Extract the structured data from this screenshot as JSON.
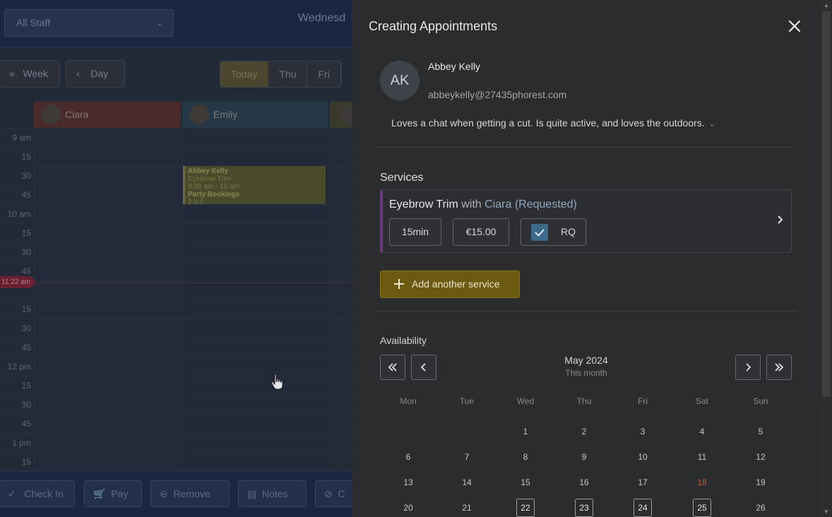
{
  "background": {
    "staff_filter": "All Staff",
    "date_label": "Wednesd",
    "nav": {
      "week": "Week",
      "day": "Day"
    },
    "range_tabs": [
      "Today",
      "Thu",
      "Fri"
    ],
    "staff": [
      "Ciara",
      "Emily"
    ],
    "time_labels": [
      "9 am",
      "15",
      "30",
      "45",
      "10 am",
      "15",
      "30",
      "45",
      "",
      "15",
      "30",
      "45",
      "12 pm",
      "15",
      "30",
      "45",
      "1 pm",
      "15"
    ],
    "appointment": {
      "client": "Abbey Kelly",
      "service": "Eyebrow Trim",
      "time": "9:30 am - 10 am",
      "extra": "Party Bookings",
      "extra2": "2 h 0"
    },
    "now_label": "11:22 am",
    "footer_buttons": [
      "Check In",
      "Pay",
      "Remove",
      "Notes",
      "C"
    ]
  },
  "panel": {
    "title": "Creating Appointments",
    "client": {
      "initials": "AK",
      "name": "Abbey Kelly",
      "email": "abbeykelly@27435phorest.com",
      "notes": "Loves a chat when getting a cut. Is quite active, and loves the outdoors."
    },
    "services": {
      "heading": "Services",
      "item": {
        "name": "Eyebrow Trim",
        "with": "with",
        "staff": "Ciara (Requested)",
        "duration": "15min",
        "price": "€15.00",
        "rq_label": "RQ"
      },
      "add_button": "Add another service"
    },
    "availability": {
      "heading": "Availability",
      "month": "May 2024",
      "month_sub": "This month",
      "weekdays": [
        "Mon",
        "Tue",
        "Wed",
        "Thu",
        "Fri",
        "Sat",
        "Sun"
      ],
      "weeks": [
        [
          "",
          "",
          "1",
          "2",
          "3",
          "4",
          "5"
        ],
        [
          "6",
          "7",
          "8",
          "9",
          "10",
          "11",
          "12"
        ],
        [
          "13",
          "14",
          "15",
          "16",
          "17",
          "18",
          "19"
        ],
        [
          "20",
          "21",
          "22",
          "23",
          "24",
          "25",
          "26"
        ]
      ],
      "today": "18",
      "boxed_days": [
        "22",
        "23",
        "24",
        "25"
      ]
    }
  },
  "colors": {
    "accent_yellow": "#6b5a10",
    "service_bar": "#6b3a7a",
    "today_red": "#c65a36"
  }
}
